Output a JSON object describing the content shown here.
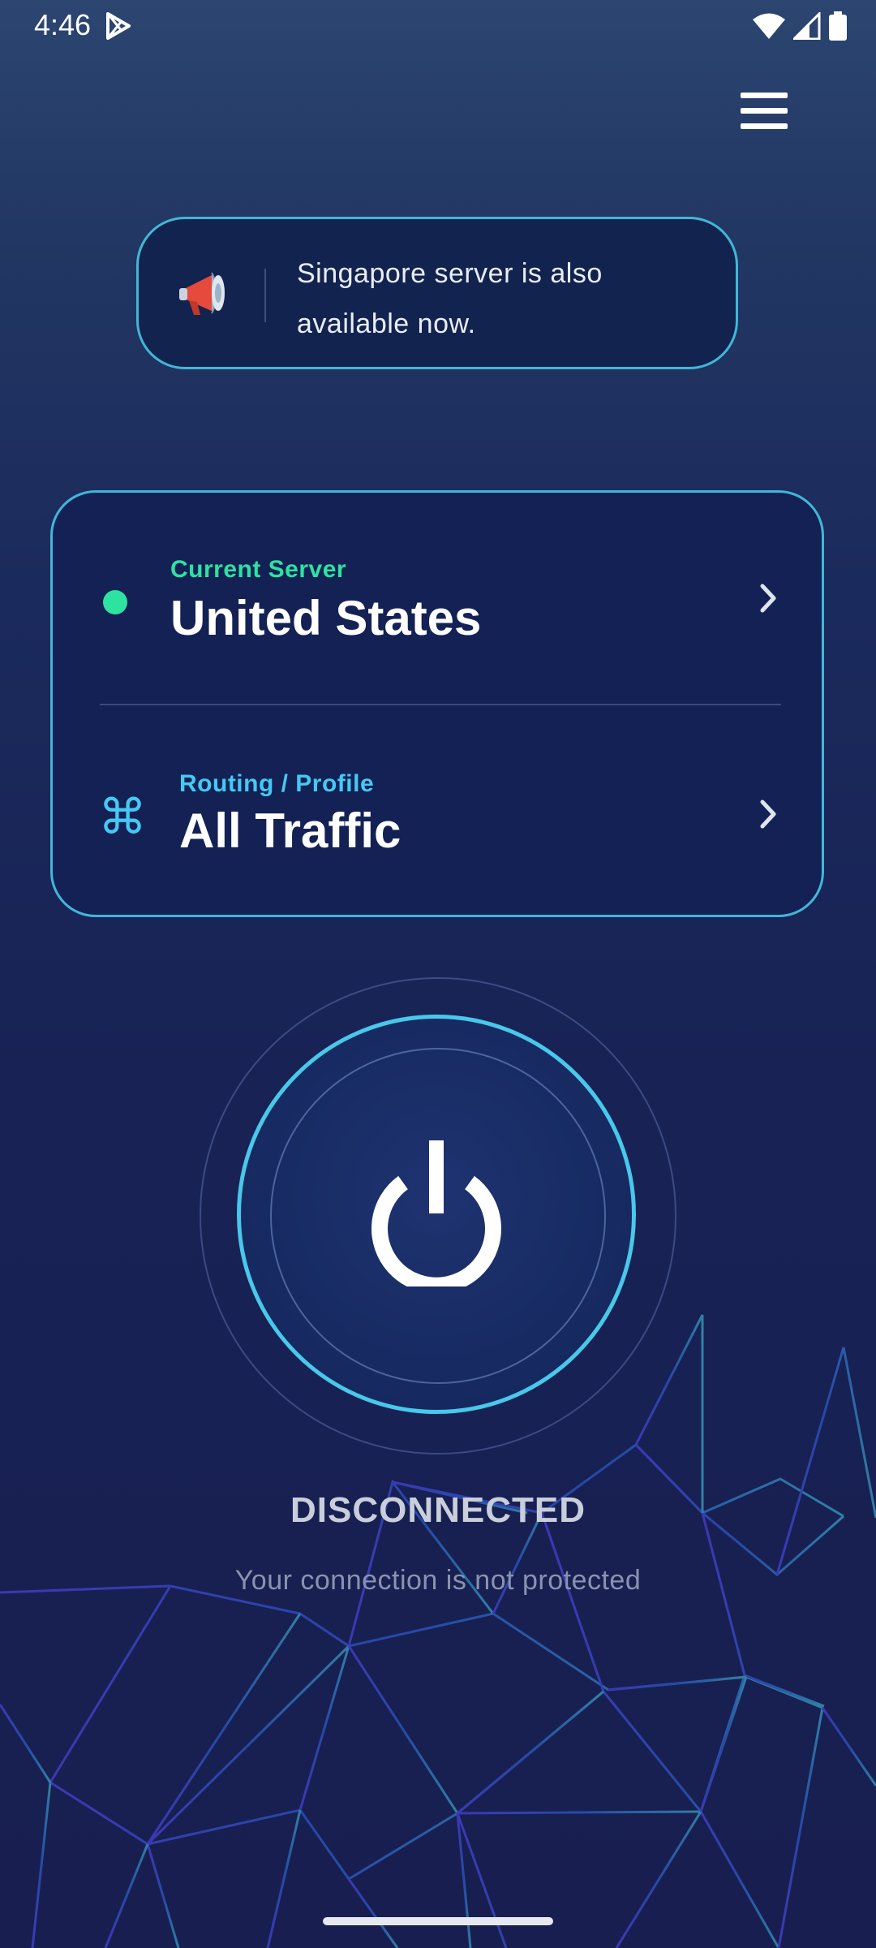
{
  "status_bar": {
    "time": "4:46",
    "icons": [
      "play-store-icon",
      "wifi-icon",
      "signal-icon",
      "battery-icon"
    ]
  },
  "menu": {
    "icon": "hamburger-menu-icon"
  },
  "announcement": {
    "icon": "megaphone-icon",
    "text": "Singapore server is also available now."
  },
  "server_card": {
    "current_server": {
      "label": "Current Server",
      "value": "United States",
      "status_color": "#2ee2a0"
    },
    "routing": {
      "label": "Routing / Profile",
      "value": "All Traffic",
      "icon": "⌘",
      "accent_color": "#45c9f2"
    }
  },
  "power": {
    "icon": "power-icon",
    "ring_color": "#48c8ea"
  },
  "connection": {
    "status": "DISCONNECTED",
    "subtitle": "Your connection is not protected"
  }
}
